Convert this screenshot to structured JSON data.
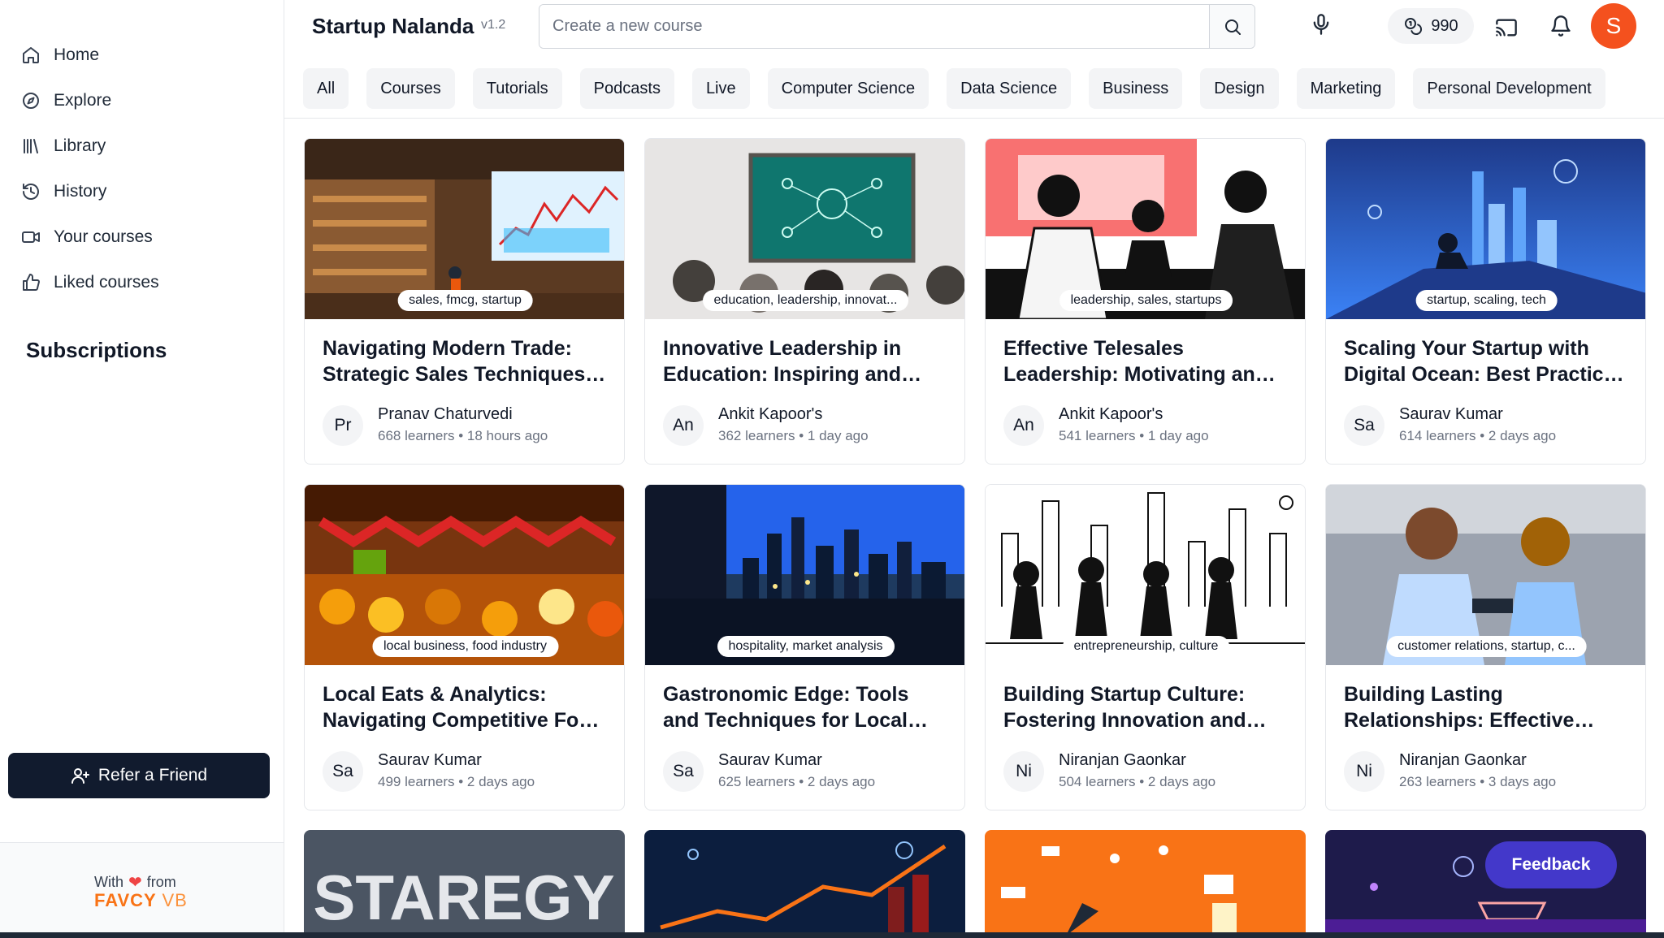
{
  "sidebar": {
    "nav": [
      {
        "label": "Home",
        "icon": "home-icon"
      },
      {
        "label": "Explore",
        "icon": "compass-icon"
      },
      {
        "label": "Library",
        "icon": "library-icon"
      },
      {
        "label": "History",
        "icon": "history-icon"
      },
      {
        "label": "Your courses",
        "icon": "video-icon"
      },
      {
        "label": "Liked courses",
        "icon": "thumbs-up-icon"
      }
    ],
    "subscriptions_title": "Subscriptions",
    "refer_label": "Refer a Friend",
    "footer": {
      "with": "With",
      "from": "from",
      "brand_a": "FAVCY",
      "brand_b": "VB"
    }
  },
  "header": {
    "title": "Startup Nalanda",
    "version": "v1.2",
    "search_placeholder": "Create a new course",
    "credits": "990",
    "avatar_letter": "S"
  },
  "chips": [
    "All",
    "Courses",
    "Tutorials",
    "Podcasts",
    "Live",
    "Computer Science",
    "Data Science",
    "Business",
    "Design",
    "Marketing",
    "Personal Development"
  ],
  "courses": [
    {
      "tags": "sales, fmcg, startup",
      "title": "Navigating Modern Trade: Strategic Sales Techniques for FMCG Startups",
      "initials": "Pr",
      "author": "Pranav Chaturvedi",
      "meta": "668 learners • 18 hours ago"
    },
    {
      "tags": "education, leadership, innovat...",
      "title": "Innovative Leadership in Education: Inspiring and Empowering Teams",
      "initials": "An",
      "author": "Ankit Kapoor's",
      "meta": "362 learners • 1 day ago"
    },
    {
      "tags": "leadership, sales, startups",
      "title": "Effective Telesales Leadership: Motivating and Managing Teams",
      "initials": "An",
      "author": "Ankit Kapoor's",
      "meta": "541 learners • 1 day ago"
    },
    {
      "tags": "startup, scaling, tech",
      "title": "Scaling Your Startup with Digital Ocean: Best Practices and Tools",
      "initials": "Sa",
      "author": "Saurav Kumar",
      "meta": "614 learners • 2 days ago"
    },
    {
      "tags": "local business, food industry",
      "title": "Local Eats & Analytics: Navigating Competitive Food Markets",
      "initials": "Sa",
      "author": "Saurav Kumar",
      "meta": "499 learners • 2 days ago"
    },
    {
      "tags": "hospitality, market analysis",
      "title": "Gastronomic Edge: Tools and Techniques for Local Hospitality",
      "initials": "Sa",
      "author": "Saurav Kumar",
      "meta": "625 learners • 2 days ago"
    },
    {
      "tags": "entrepreneurship, culture",
      "title": "Building Startup Culture: Fostering Innovation and Collaboration",
      "initials": "Ni",
      "author": "Niranjan Gaonkar",
      "meta": "504 learners • 2 days ago"
    },
    {
      "tags": "customer relations, startup, c...",
      "title": "Building Lasting Relationships: Effective Customer Relations",
      "initials": "Ni",
      "author": "Niranjan Gaonkar",
      "meta": "263 learners • 3 days ago"
    }
  ],
  "row3": {
    "strategy_text": "STAREGY"
  },
  "feedback_label": "Feedback"
}
